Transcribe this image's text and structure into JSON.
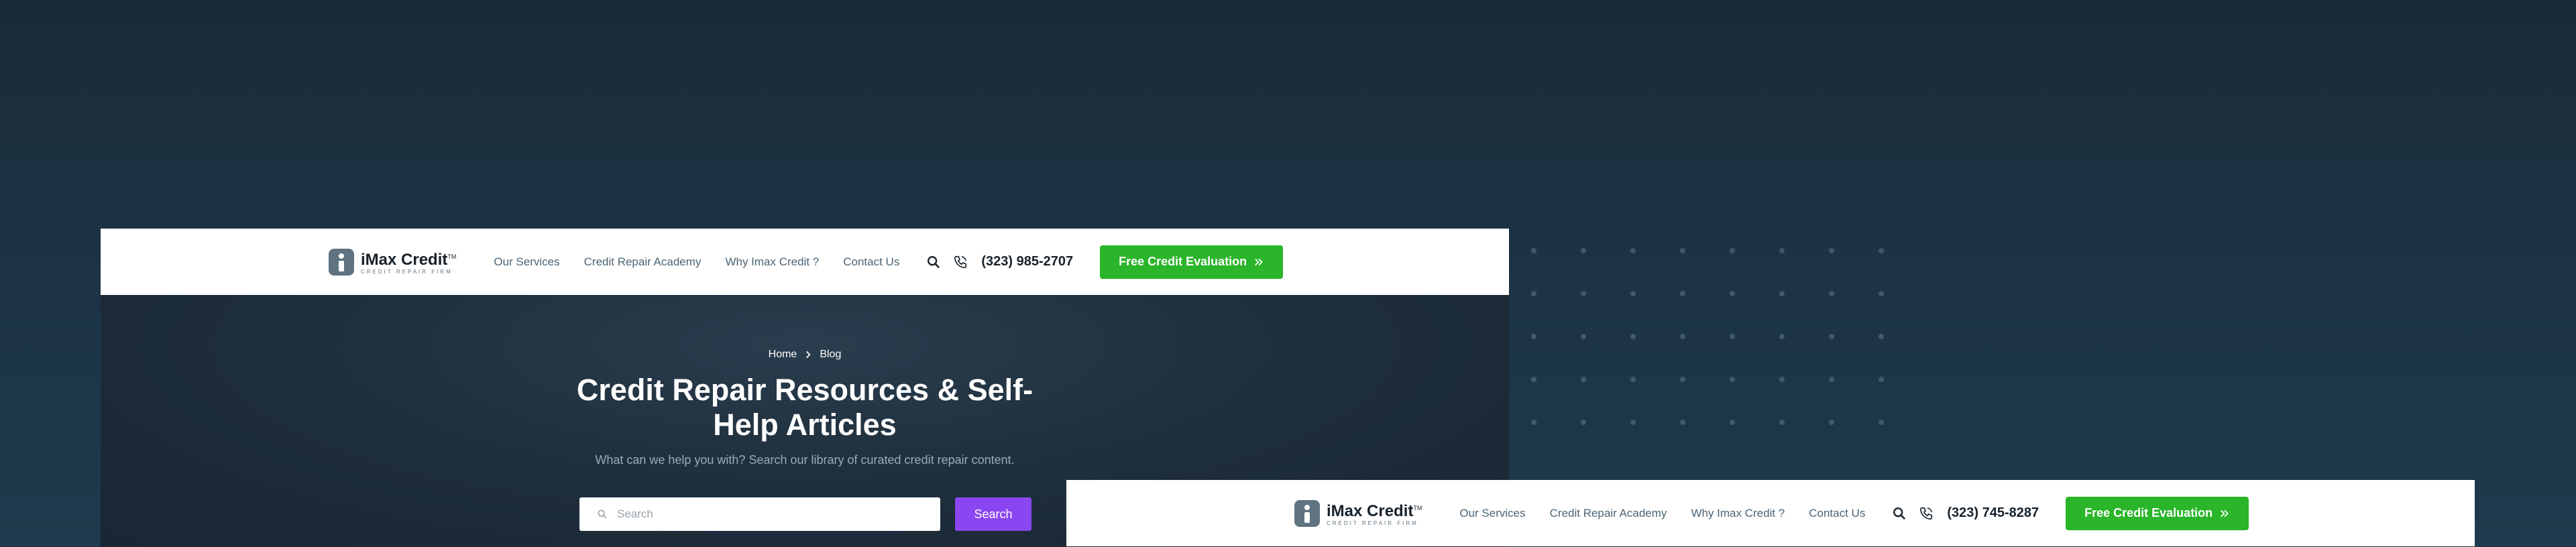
{
  "brand": {
    "name": "iMax Credit",
    "trademark": "TM",
    "tagline": "CREDIT REPAIR FIRM"
  },
  "nav_primary": {
    "menu": [
      "Our Services",
      "Credit Repair Academy",
      "Why Imax Credit ?",
      "Contact Us"
    ],
    "phone": "(323) 985-2707",
    "cta_label": "Free Credit Evaluation",
    "cta_icon": "double-chevron-right-icon",
    "search_icon": "search-icon",
    "phone_icon": "phone-icon"
  },
  "nav_sticky": {
    "menu": [
      "Our Services",
      "Credit Repair Academy",
      "Why Imax Credit ?",
      "Contact Us"
    ],
    "phone": "(323) 745-8287",
    "cta_label": "Free Credit Evaluation"
  },
  "breadcrumb": {
    "home": "Home",
    "current": "Blog",
    "separator_icon": "chevron-right-icon"
  },
  "hero": {
    "title": "Credit Repair Resources & Self-Help Articles",
    "subtitle": "What can we help you with? Search our library of curated credit repair content.",
    "search_placeholder": "Search",
    "search_button": "Search"
  },
  "colors": {
    "cta_green": "#2bb52a",
    "search_purple": "#8a46f0",
    "logo_gray": "#5f7380",
    "bg_dark": "#1c3344"
  }
}
